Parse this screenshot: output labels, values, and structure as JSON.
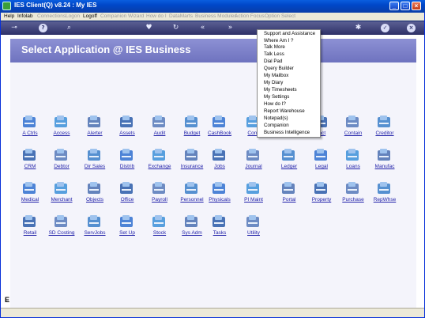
{
  "window": {
    "title": "IES Client(Q) v8.24 : My IES",
    "buttons": [
      "_",
      "□",
      "×"
    ]
  },
  "menubar": [
    {
      "label": "Help",
      "enabled": true
    },
    {
      "label": "Infolab",
      "enabled": true
    },
    {
      "label": "Connections",
      "enabled": false
    },
    {
      "label": "Logon",
      "enabled": false
    },
    {
      "label": "Logoff",
      "enabled": true
    },
    {
      "label": "Companion",
      "enabled": false
    },
    {
      "label": "Wizard",
      "enabled": false
    },
    {
      "label": "How do I",
      "enabled": false
    },
    {
      "label": "DataMarts",
      "enabled": false
    },
    {
      "label": "Business Modules",
      "enabled": false
    },
    {
      "label": "Action Focus",
      "enabled": false
    },
    {
      "label": "Option Select",
      "enabled": false
    }
  ],
  "banner": {
    "text": "Select Application @ IES Business"
  },
  "side": {
    "label": "E"
  },
  "dropdown": [
    "Support and Assistance",
    "Where Am I ?",
    "Talk More",
    "Talk Less",
    "Dial Pad",
    "Query Builder",
    "My Mailbox",
    "My Diary",
    "My Timesheets",
    "My Settings",
    "How do I?",
    "Report Warehouse",
    "Notepad(s)",
    "Companion",
    "Business Intelligence"
  ],
  "apps": [
    [
      "A Ctrls",
      "Access",
      "Alerter",
      "Assets",
      "Audit",
      "Budget",
      "CashBook",
      "Conc",
      "",
      "tact",
      "Contain",
      "Creditor"
    ],
    [
      "CRM",
      "Debtor",
      "Dir Sales",
      "Distrib",
      "Exchange",
      "Insurance",
      "Jobs",
      "Journal",
      "Ledger",
      "Legal",
      "Loans",
      "Manufac"
    ],
    [
      "Medical",
      "Merchant",
      "Objects",
      "Office",
      "Payroll",
      "Personnel",
      "Physicals",
      "PI Maint",
      "Portal",
      "Property",
      "Purchase",
      "RepWhse"
    ],
    [
      "Retail",
      "SD Costing",
      "ServJobs",
      "Set Up",
      "Stock",
      "Sys Adm",
      "Tasks",
      "Utility"
    ]
  ],
  "colors": {
    "banner": "#7b80c9",
    "link": "#1f1fa8",
    "titlebar": "#0047c8",
    "toolbar": "#3a3d78"
  }
}
